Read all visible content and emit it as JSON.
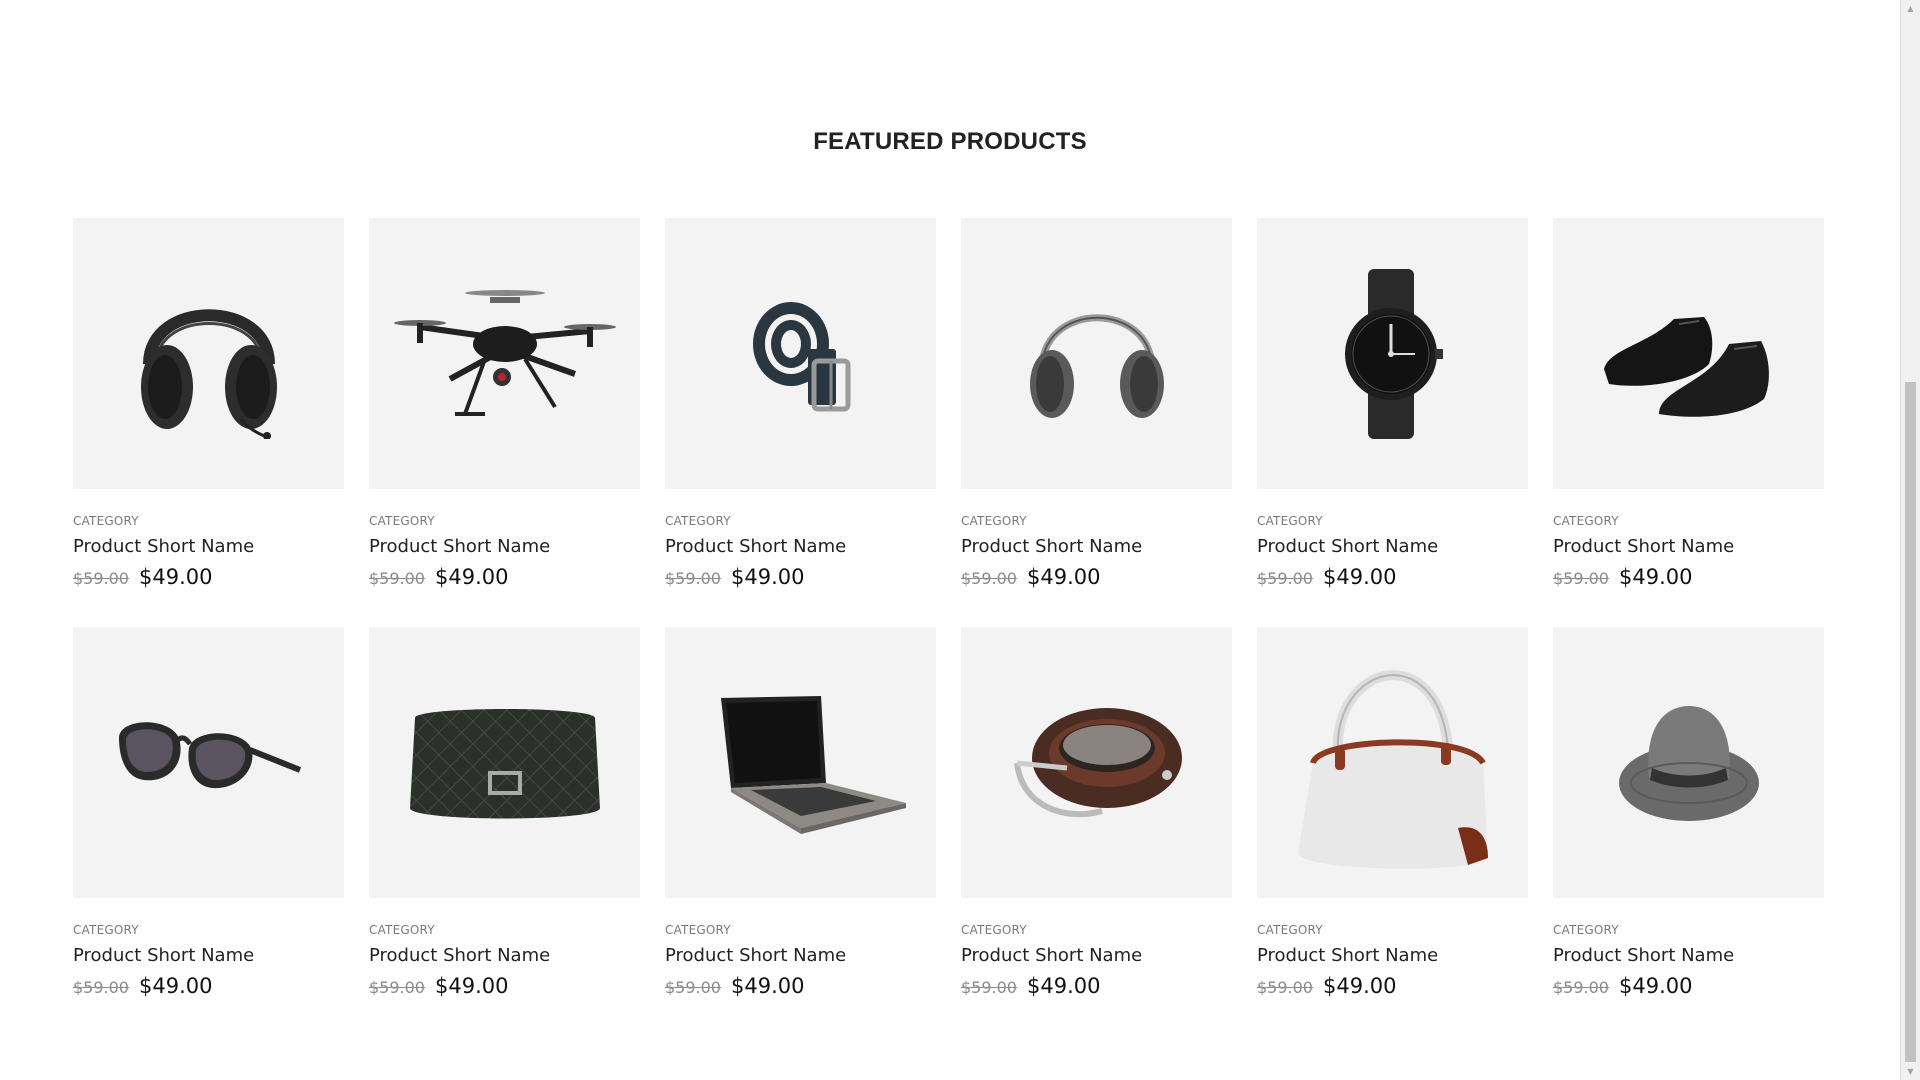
{
  "section": {
    "title": "FEATURED PRODUCTS"
  },
  "products": [
    {
      "category": "CATEGORY",
      "name": "Product Short Name",
      "old_price": "$59.00",
      "price": "$49.00",
      "image": "headphones"
    },
    {
      "category": "CATEGORY",
      "name": "Product Short Name",
      "old_price": "$59.00",
      "price": "$49.00",
      "image": "drone"
    },
    {
      "category": "CATEGORY",
      "name": "Product Short Name",
      "old_price": "$59.00",
      "price": "$49.00",
      "image": "belt-rolled"
    },
    {
      "category": "CATEGORY",
      "name": "Product Short Name",
      "old_price": "$59.00",
      "price": "$49.00",
      "image": "ear-muffs"
    },
    {
      "category": "CATEGORY",
      "name": "Product Short Name",
      "old_price": "$59.00",
      "price": "$49.00",
      "image": "wristwatch"
    },
    {
      "category": "CATEGORY",
      "name": "Product Short Name",
      "old_price": "$59.00",
      "price": "$49.00",
      "image": "shoes"
    },
    {
      "category": "CATEGORY",
      "name": "Product Short Name",
      "old_price": "$59.00",
      "price": "$49.00",
      "image": "sunglasses"
    },
    {
      "category": "CATEGORY",
      "name": "Product Short Name",
      "old_price": "$59.00",
      "price": "$49.00",
      "image": "quilted-bag"
    },
    {
      "category": "CATEGORY",
      "name": "Product Short Name",
      "old_price": "$59.00",
      "price": "$49.00",
      "image": "laptop"
    },
    {
      "category": "CATEGORY",
      "name": "Product Short Name",
      "old_price": "$59.00",
      "price": "$49.00",
      "image": "brown-belt"
    },
    {
      "category": "CATEGORY",
      "name": "Product Short Name",
      "old_price": "$59.00",
      "price": "$49.00",
      "image": "handbag"
    },
    {
      "category": "CATEGORY",
      "name": "Product Short Name",
      "old_price": "$59.00",
      "price": "$49.00",
      "image": "fedora-hat"
    }
  ],
  "colors": {
    "tile_background": "#f3f3f3",
    "text_primary": "#222222",
    "text_muted": "#7a7a7a"
  }
}
